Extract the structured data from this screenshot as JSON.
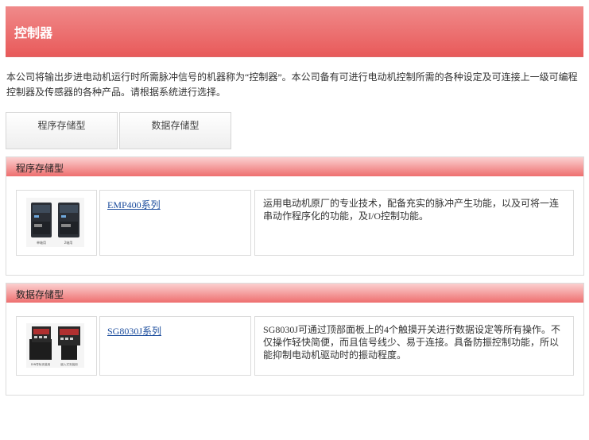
{
  "header": {
    "title": "控制器"
  },
  "intro": "本公司将输出步进电动机运行时所需脉冲信号的机器称为“控制器”。本公司备有可进行电动机控制所需的各种设定及可连接上一级可编程控制器及传感器的各种产品。请根据系统进行选择。",
  "tabs": [
    {
      "label": "程序存储型"
    },
    {
      "label": "数据存储型"
    }
  ],
  "sections": [
    {
      "title": "程序存储型",
      "product": {
        "name": "EMP400系列",
        "description": "运用电动机原厂的专业技术，配备充实的脉冲产生功能，以及可将一连串动作程序化的功能，及I/O控制功能。",
        "image_captions": [
          "单轴用",
          "2轴用"
        ]
      }
    },
    {
      "title": "数据存储型",
      "product": {
        "name": "SG8030J系列",
        "description": "SG8030J可通过顶部面板上的4个触摸开关进行数据设定等所有操作。不仅操作轻快简便，而且信号线少、易于连接。具备防振控制功能，所以能抑制电动机驱动时的振动程度。",
        "image_captions": [
          "DIN导轨安装用",
          "嵌入式安装用"
        ]
      }
    }
  ]
}
